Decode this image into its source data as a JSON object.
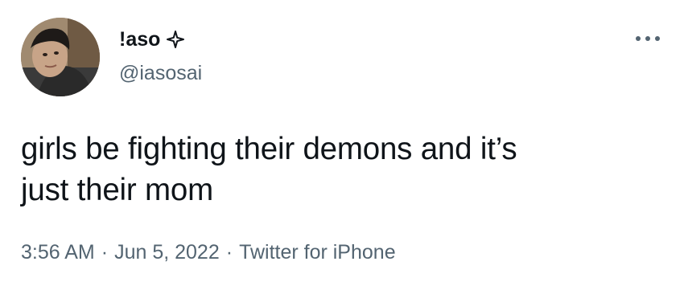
{
  "author": {
    "display_name": "!aso",
    "handle": "@iasosai",
    "name_badge_icon": "sparkle-icon",
    "avatar_icon": "user-photo"
  },
  "tweet": {
    "text_line1": "girls be fighting their demons and it’s",
    "text_line2": "just their mom"
  },
  "meta": {
    "time": "3:56 AM",
    "separator": "·",
    "date": "Jun 5, 2022",
    "source": "Twitter for iPhone"
  },
  "menu": {
    "icon": "more-horizontal-icon"
  },
  "colors": {
    "text_primary": "#0f1419",
    "text_secondary": "#536471",
    "background": "#ffffff"
  }
}
